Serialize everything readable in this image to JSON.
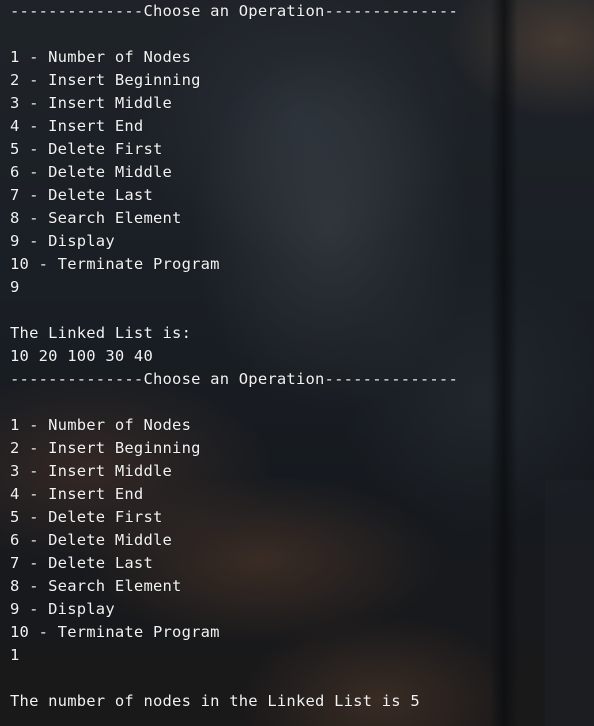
{
  "terminal": {
    "lines": [
      "--------------Choose an Operation--------------",
      "",
      "1 - Number of Nodes",
      "2 - Insert Beginning",
      "3 - Insert Middle",
      "4 - Insert End",
      "5 - Delete First",
      "6 - Delete Middle",
      "7 - Delete Last",
      "8 - Search Element",
      "9 - Display",
      "10 - Terminate Program",
      "9",
      "",
      "The Linked List is:",
      "10 20 100 30 40",
      "--------------Choose an Operation--------------",
      "",
      "1 - Number of Nodes",
      "2 - Insert Beginning",
      "3 - Insert Middle",
      "4 - Insert End",
      "5 - Delete First",
      "6 - Delete Middle",
      "7 - Delete Last",
      "8 - Search Element",
      "9 - Display",
      "10 - Terminate Program",
      "1",
      "",
      "The number of nodes in the Linked List is 5"
    ]
  }
}
